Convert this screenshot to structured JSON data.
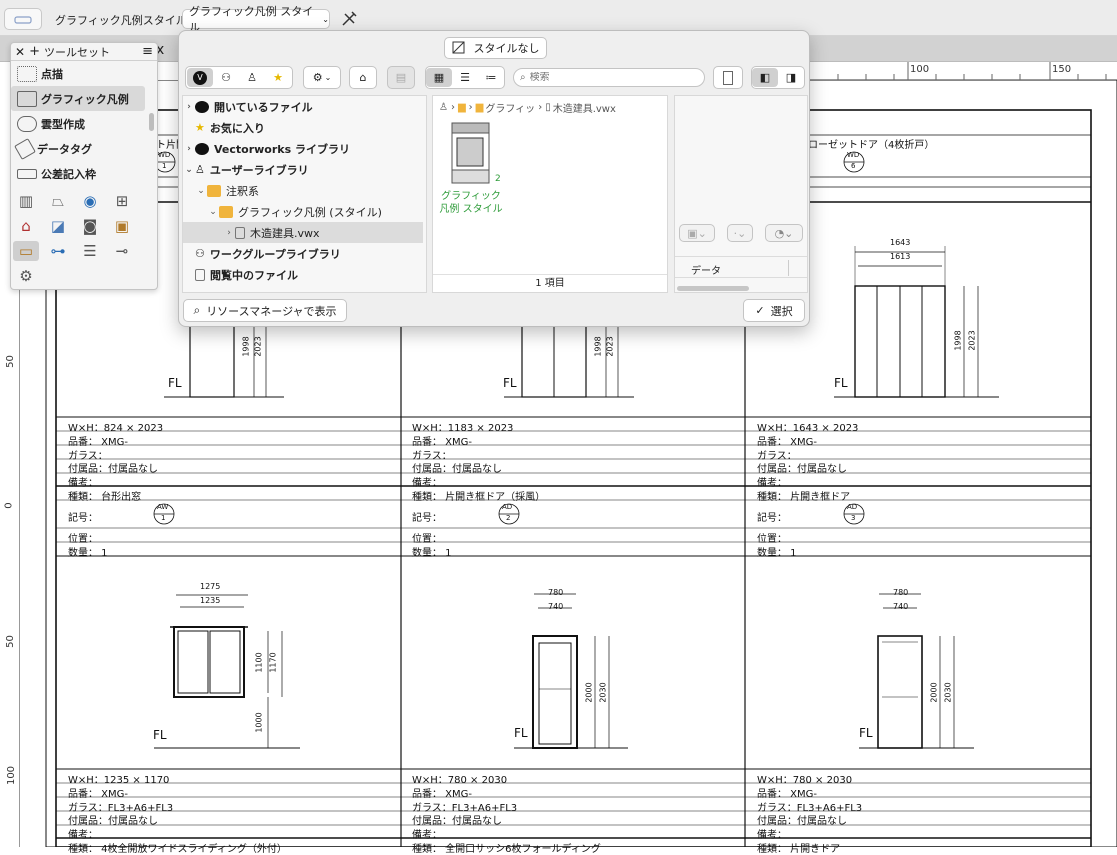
{
  "toolbar": {
    "label": "グラフィック凡例スタイル",
    "select_value": "グラフィック凡例 スタイル"
  },
  "document_tab_fragment": "x",
  "ruler": {
    "top": [
      "100",
      "150"
    ],
    "left": [
      "50",
      "0",
      "50",
      "100"
    ]
  },
  "palette": {
    "title": "ツールセット",
    "items": [
      {
        "label": "点描",
        "icon": "stipple-icon"
      },
      {
        "label": "グラフィック凡例",
        "icon": "graphic-legend-icon"
      },
      {
        "label": "雲型作成",
        "icon": "cloud-icon"
      },
      {
        "label": "データタグ",
        "icon": "data-tag-icon"
      },
      {
        "label": "公差記入枠",
        "icon": "tolerance-frame-icon"
      }
    ],
    "tools": [
      "window-tool-icon",
      "door-tool-icon",
      "globe-tool-icon",
      "grid-tool-icon",
      "building-tool-icon",
      "stair-tool-icon",
      "camera-tool-icon",
      "sign-tool-icon",
      "ruler-tool-icon",
      "plumbing-tool-icon",
      "shelf-tool-icon",
      "key-tool-icon",
      "gear-tool-icon"
    ]
  },
  "popup": {
    "no_style_label": "スタイルなし",
    "search_placeholder": "検索",
    "tree": [
      {
        "label": "開いているファイル",
        "icon": "vectorworks-icon",
        "bold": true
      },
      {
        "label": "お気に入り",
        "icon": "star-icon",
        "bold": true
      },
      {
        "label": "Vectorworks ライブラリ",
        "icon": "vectorworks-icon",
        "bold": true
      },
      {
        "label": "ユーザーライブラリ",
        "icon": "user-icon",
        "bold": true
      },
      {
        "label": "注釈系",
        "icon": "folder-icon",
        "bold": false
      },
      {
        "label": "グラフィック凡例 (スタイル)",
        "icon": "folder-icon",
        "bold": false
      },
      {
        "label": "木造建具.vwx",
        "icon": "file-icon",
        "bold": false
      },
      {
        "label": "ワークグループライブラリ",
        "icon": "group-icon",
        "bold": true
      },
      {
        "label": "閲覧中のファイル",
        "icon": "file-icon",
        "bold": true
      }
    ],
    "breadcrumb": [
      "グラフィッ",
      "木造建具.vwx"
    ],
    "resource_label": "グラフィック凡例 スタイル",
    "resource_badge": "2",
    "item_count": "1 項目",
    "info_tab": "データ",
    "show_in_manager": "リソースマネージャで表示",
    "select_button": "選択"
  },
  "drawing": {
    "row1_headers": [
      "ト片開",
      "ローゼットドア（4枚折戸）"
    ],
    "row1_symbols": [
      {
        "code": "WD",
        "num": "1"
      },
      {
        "code": "WD",
        "num": "6"
      }
    ],
    "row1_dims": [
      {
        "h1": "1998",
        "h2": "2023"
      },
      {
        "h1": "1998",
        "h2": "2023"
      },
      {
        "w1": "1643",
        "w2": "1613",
        "h1": "1998",
        "h2": "2023"
      }
    ],
    "fl": "FL",
    "cells": [
      {
        "wh": "W×H：824 × 2023",
        "part": "品番：  XMG-",
        "glass": "ガラス：",
        "acc": "付属品：付属品なし",
        "note": "備考：",
        "kind": "種類：  台形出窓",
        "sym_label": "記号：",
        "sym_code": "AW",
        "sym_num": "1",
        "pos": "位置：",
        "qty": "数量：  1"
      },
      {
        "wh": "W×H：1183 × 2023",
        "part": "品番：  XMG-",
        "glass": "ガラス：",
        "acc": "付属品：付属品なし",
        "note": "備考：",
        "kind": "種類：  片開き框ドア（採風）",
        "sym_label": "記号：",
        "sym_code": "AD",
        "sym_num": "2",
        "pos": "位置：",
        "qty": "数量：  1"
      },
      {
        "wh": "W×H：1643 × 2023",
        "part": "品番：  XMG-",
        "glass": "ガラス：",
        "acc": "付属品：付属品なし",
        "note": "備考：",
        "kind": "種類：  片開き框ドア",
        "sym_label": "記号：",
        "sym_code": "AD",
        "sym_num": "3",
        "pos": "位置：",
        "qty": "数量：  1"
      }
    ],
    "row2_dims": [
      {
        "w1": "1275",
        "w2": "1235",
        "h1": "1100",
        "h2": "1170",
        "h3": "1000"
      },
      {
        "w1": "780",
        "w2": "740",
        "h1": "2000",
        "h2": "2030"
      },
      {
        "w1": "780",
        "w2": "740",
        "h1": "2000",
        "h2": "2030"
      }
    ],
    "cells2": [
      {
        "wh": "W×H：1235 × 1170",
        "part": "品番：  XMG-",
        "glass": "ガラス：FL3+A6+FL3",
        "acc": "付属品：付属品なし",
        "note": "備考：",
        "kind": "種類：  4枚全開放ワイドスライディング（外付）"
      },
      {
        "wh": "W×H：780 × 2030",
        "part": "品番：  XMG-",
        "glass": "ガラス：FL3+A6+FL3",
        "acc": "付属品：付属品なし",
        "note": "備考：",
        "kind": "種類：  全開口サッシ6枚フォールディング"
      },
      {
        "wh": "W×H：780 × 2030",
        "part": "品番：  XMG-",
        "glass": "ガラス：FL3+A6+FL3",
        "acc": "付属品：付属品なし",
        "note": "備考：",
        "kind": "種類：  片開きドア"
      }
    ]
  }
}
